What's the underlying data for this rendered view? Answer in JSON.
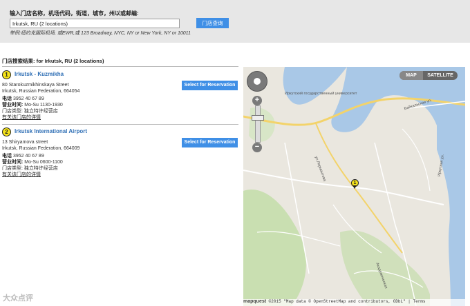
{
  "search": {
    "label": "输入门店名称，机场代码，街道，城市，州以或邮编:",
    "value": "Irkutsk, RU (2 locations)",
    "button": "门店查询",
    "hint": "举例:纽约克国际机场, 或EWR,或 123 Broadway, NYC, NY or New York, NY or 10011"
  },
  "results": {
    "title": "门店搜索结果: for Irkutsk, RU (2 locations)",
    "items": [
      {
        "number": "1",
        "name": "Irkutsk - Kuzmikha",
        "street": "80 Starokuzmikhinskaya Street",
        "city": "Irkutsk, Russian Federation, 664054",
        "phone_label": "电话",
        "phone": "3952 40 67 89",
        "hours_label": "营业时间:",
        "hours": "Mo-Su 1130-1930",
        "type_label": "门店类型:",
        "type": "独立特许经营店",
        "details_link": "有关该门店的详情",
        "reserve_button": "Select for Reservation"
      },
      {
        "number": "2",
        "name": "Irkutsk International Airport",
        "street": "13 Shiryamova street",
        "city": "Irkutsk, Russian Federation, 664009",
        "phone_label": "电话",
        "phone": "3952 40 67 89",
        "hours_label": "营业时间:",
        "hours": "Mo-Su 0600-1100",
        "type_label": "门店类型:",
        "type": "独立特许经营店",
        "details_link": "有关该门店的详情",
        "reserve_button": "Select for Reservation"
      }
    ]
  },
  "map": {
    "type_map": "MAP",
    "type_satellite": "SATELLITE",
    "zoom_in": "+",
    "zoom_out": "−",
    "pin_number": "1",
    "attribution_logo": "mapquest",
    "attribution_text": "©2015  \"Map data © OpenStreetMap and contributors, ODbL\" | Terms",
    "labels": {
      "university": "Иркутский государственный университет",
      "street1": "Байкальская ул.",
      "street2": "ул.Лермонтова",
      "street3": "Иркутная ул.",
      "street4": "Академическая"
    },
    "colors": {
      "water": "#a9c8e7",
      "land": "#eae7df",
      "green": "#c9dfb1",
      "road": "#f3d36a"
    }
  },
  "watermark": "大众点评"
}
